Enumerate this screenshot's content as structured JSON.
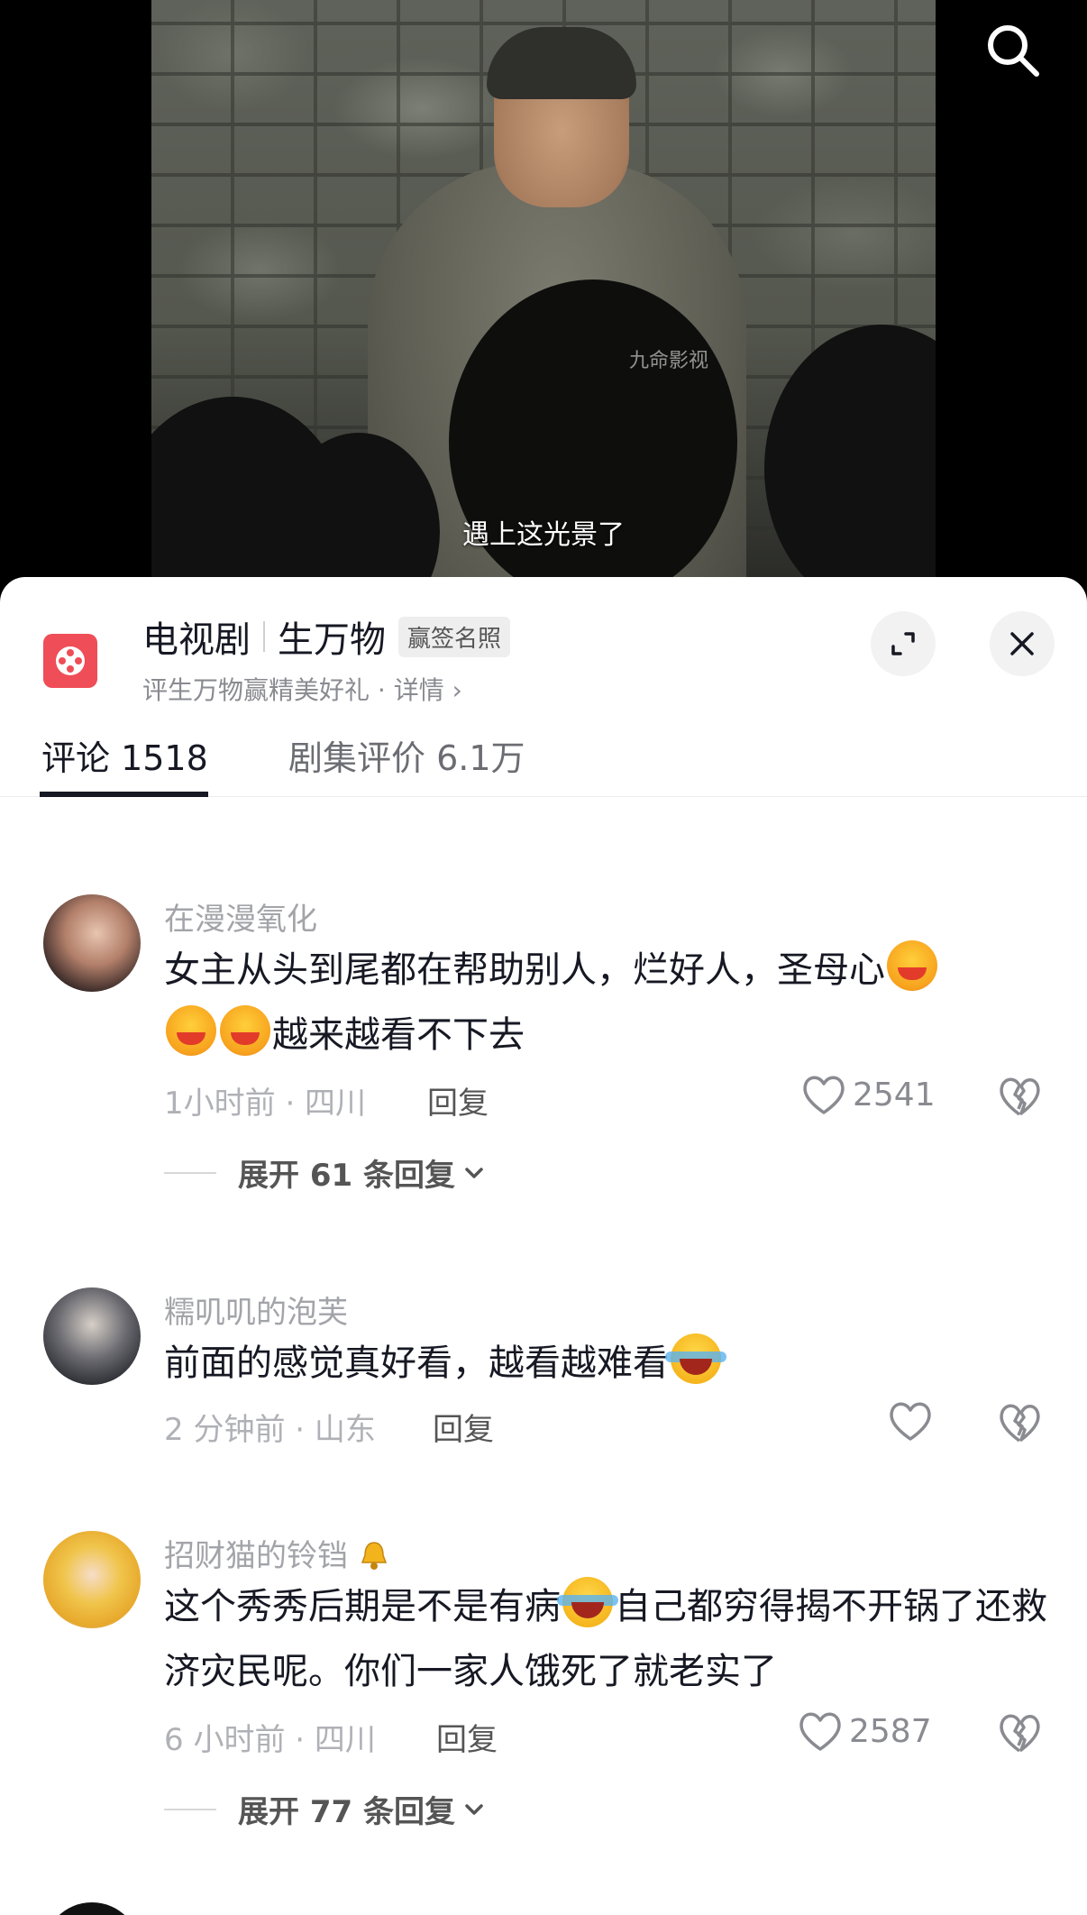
{
  "video": {
    "watermark": "九命影视",
    "subtitle": "遇上这光景了"
  },
  "header": {
    "category": "电视剧",
    "show_title": "生万物",
    "badge": "赢签名照",
    "promo_link": "评生万物赢精美好礼 · 详情 ›"
  },
  "tabs": [
    {
      "label": "评论 1518",
      "active": true
    },
    {
      "label": "剧集评价 6.1万",
      "active": false
    }
  ],
  "comments": [
    {
      "username": "在漫漫氧化",
      "content_part1": "女主从头到尾都在帮助别人，烂好人，圣母心",
      "content_part2": "越来越看不下去",
      "emoji": "hot-face-emoji",
      "time_location": "1小时前 · 四川",
      "reply_label": "回复",
      "likes": "2541",
      "expand_label": "展开 61 条回复"
    },
    {
      "username": "糯叽叽的泡芙",
      "content_part1": "前面的感觉真好看，越看越难看",
      "emoji": "laugh-cry-emoji",
      "time_location": "2 分钟前 · 山东",
      "reply_label": "回复",
      "likes": ""
    },
    {
      "username": "招财猫的铃铛",
      "content_part1": "这个秀秀后期是不是有病",
      "content_part2": "自己都穷得揭不开锅了还救济灾民呢。你们一家人饿死了就老实了",
      "emoji": "laugh-cry-emoji",
      "time_location": "6 小时前 · 四川",
      "reply_label": "回复",
      "likes": "2587",
      "expand_label": "展开 77 条回复"
    }
  ],
  "colors": {
    "logo_red": "#ef4d57",
    "text_primary": "#161823",
    "text_secondary": "#a3a4a9"
  }
}
